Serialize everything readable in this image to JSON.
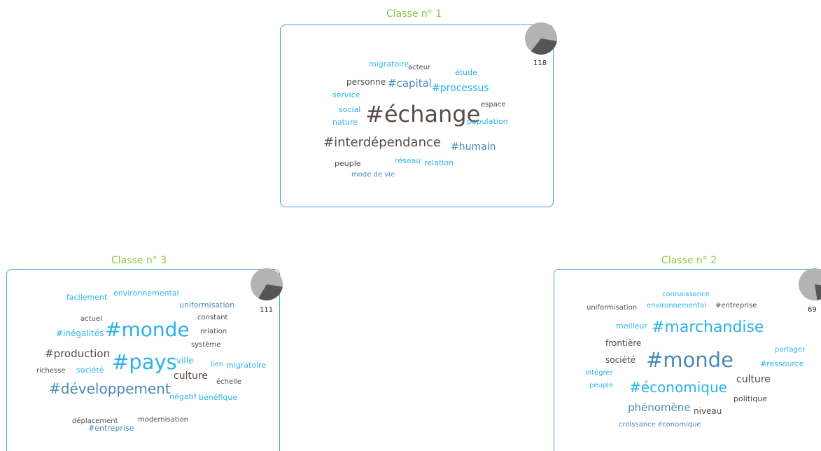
{
  "colors": {
    "title": "#8cc63f",
    "border": "#3aa3d8",
    "dark": "#4e4e4e",
    "brown": "#5a4a44",
    "blue": "#2bb3e8",
    "steel": "#4a8ab5",
    "pie_light": "#b3b3b3",
    "pie_dark": "#555555"
  },
  "classes": [
    {
      "id": "c1",
      "title": "Classe n° 1",
      "count": "118",
      "share": 0.33,
      "words": [
        {
          "t": "migratoire",
          "c": "blue"
        },
        {
          "t": "acteur",
          "c": "dark"
        },
        {
          "t": "étude",
          "c": "blue"
        },
        {
          "t": "personne",
          "c": "dark"
        },
        {
          "t": "#capital",
          "c": "steel"
        },
        {
          "t": "#processus",
          "c": "blue"
        },
        {
          "t": "service",
          "c": "blue"
        },
        {
          "t": "social",
          "c": "blue"
        },
        {
          "t": "#échange",
          "c": "brown"
        },
        {
          "t": "espace",
          "c": "dark"
        },
        {
          "t": "nature",
          "c": "blue"
        },
        {
          "t": "population",
          "c": "blue"
        },
        {
          "t": "#interdépendance",
          "c": "brown"
        },
        {
          "t": "#humain",
          "c": "steel"
        },
        {
          "t": "peuple",
          "c": "dark"
        },
        {
          "t": "réseau",
          "c": "blue"
        },
        {
          "t": "relation",
          "c": "blue"
        },
        {
          "t": "mode de vie",
          "c": "steel"
        }
      ]
    },
    {
      "id": "c3",
      "title": "Classe n° 3",
      "count": "111",
      "share": 0.31,
      "words": [
        {
          "t": "facilement",
          "c": "blue"
        },
        {
          "t": "environnemental",
          "c": "blue"
        },
        {
          "t": "uniformisation",
          "c": "steel"
        },
        {
          "t": "actuel",
          "c": "dark"
        },
        {
          "t": "constant",
          "c": "dark"
        },
        {
          "t": "#inégalités",
          "c": "blue"
        },
        {
          "t": "#monde",
          "c": "blue"
        },
        {
          "t": "relation",
          "c": "dark"
        },
        {
          "t": "système",
          "c": "dark"
        },
        {
          "t": "#production",
          "c": "brown"
        },
        {
          "t": "richesse",
          "c": "dark"
        },
        {
          "t": "société",
          "c": "blue"
        },
        {
          "t": "#pays",
          "c": "blue"
        },
        {
          "t": "ville",
          "c": "blue"
        },
        {
          "t": "lien",
          "c": "blue"
        },
        {
          "t": "migratoire",
          "c": "blue"
        },
        {
          "t": "culture",
          "c": "brown"
        },
        {
          "t": "échelle",
          "c": "dark"
        },
        {
          "t": "#développement",
          "c": "steel"
        },
        {
          "t": "négatif",
          "c": "blue"
        },
        {
          "t": "bénéfique",
          "c": "blue"
        },
        {
          "t": "#entreprise",
          "c": "steel"
        },
        {
          "t": "déplacement",
          "c": "dark"
        },
        {
          "t": "modernisation",
          "c": "dark"
        }
      ]
    },
    {
      "id": "c2",
      "title": "Classe n° 2",
      "count": "69",
      "share": 0.2,
      "words": [
        {
          "t": "connaissance",
          "c": "blue"
        },
        {
          "t": "uniformisation",
          "c": "dark"
        },
        {
          "t": "environnemental",
          "c": "blue"
        },
        {
          "t": "#entreprise",
          "c": "dark"
        },
        {
          "t": "meilleur",
          "c": "blue"
        },
        {
          "t": "#marchandise",
          "c": "blue"
        },
        {
          "t": "frontière",
          "c": "brown"
        },
        {
          "t": "partager",
          "c": "blue"
        },
        {
          "t": "société",
          "c": "brown"
        },
        {
          "t": "#monde",
          "c": "steel"
        },
        {
          "t": "#ressource",
          "c": "blue"
        },
        {
          "t": "intégrer",
          "c": "blue"
        },
        {
          "t": "culture",
          "c": "dark"
        },
        {
          "t": "peuple",
          "c": "blue"
        },
        {
          "t": "#économique",
          "c": "blue"
        },
        {
          "t": "politique",
          "c": "dark"
        },
        {
          "t": "phénomène",
          "c": "steel"
        },
        {
          "t": "niveau",
          "c": "brown"
        },
        {
          "t": "croissance économique",
          "c": "steel"
        }
      ]
    }
  ]
}
